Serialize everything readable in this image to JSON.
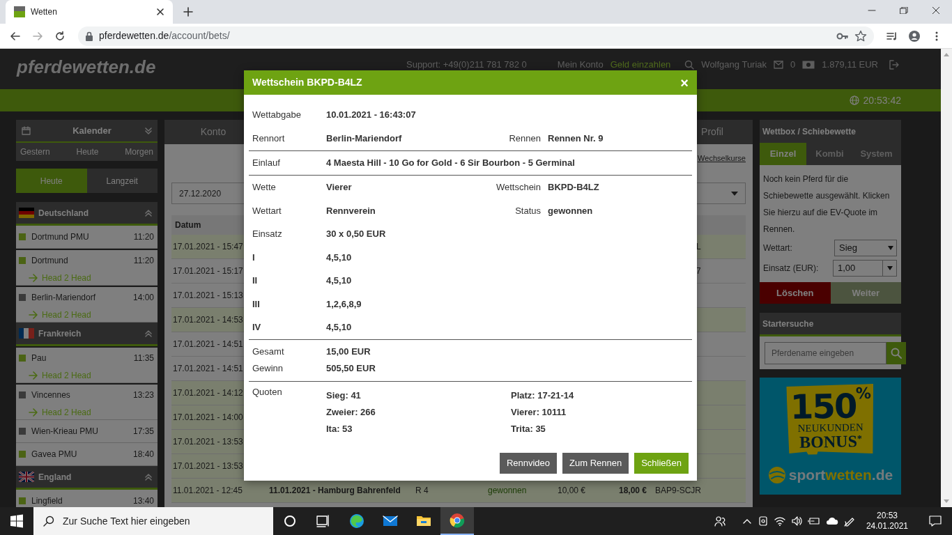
{
  "browser": {
    "tab_title": "Wetten",
    "url_host": "pferdewetten.de",
    "url_path": "/account/bets/"
  },
  "site_header": {
    "logo": "pferdewetten.de",
    "support": "Support: +49(0)211 781 782 0",
    "account_link": "Mein Konto",
    "deposit_link": "Geld einzahlen",
    "user": "Wolfgang Turiak",
    "messages": "0",
    "balance": "1.879,11 EUR",
    "clock": "20:53:42"
  },
  "calendar": {
    "title": "Kalender",
    "expanded": false,
    "days": [
      "Gestern",
      "Heute",
      "Morgen"
    ],
    "tabs": [
      {
        "label": "Heute",
        "selected": true
      },
      {
        "label": "Langzeit",
        "selected": false
      }
    ]
  },
  "countries": [
    {
      "name": "Deutschland",
      "kind": "de",
      "expanded": true,
      "races": [
        {
          "name": "Dortmund PMU",
          "time": "11:20",
          "color": "#4b6314"
        },
        {
          "name": "Dortmund",
          "time": "11:20",
          "color": "#4b6314",
          "link": "Head 2 Head"
        },
        {
          "name": "Berlin-Mariendorf",
          "time": "14:00",
          "color": "#3a3a3a",
          "link": "Head 2 Head"
        }
      ]
    },
    {
      "name": "Frankreich",
      "kind": "fr",
      "expanded": true,
      "races": [
        {
          "name": "Pau",
          "time": "11:35",
          "color": "#4b6314",
          "link": "Head 2 Head"
        },
        {
          "name": "Vincennes",
          "time": "13:23",
          "color": "#3a3a3a",
          "link": "Head 2 Head"
        },
        {
          "name": "Wien-Krieau PMU",
          "time": "17:35",
          "color": "#3a3a3a"
        },
        {
          "name": "Gavea PMU",
          "time": "18:40",
          "color": "#4b6314"
        }
      ]
    },
    {
      "name": "England",
      "kind": "gb",
      "expanded": true,
      "races": [
        {
          "name": "Lingfield",
          "time": "13:40",
          "color": "#4b6314"
        }
      ]
    }
  ],
  "account": {
    "tabs": [
      {
        "label": "Konto",
        "selected": false
      },
      {
        "label": "Profil",
        "selected": false
      }
    ],
    "rate_link": "Wechselkurse",
    "date_from": "27.12.2020",
    "table": {
      "columns": [
        "Datum"
      ],
      "rows": [
        {
          "cells": [
            "17.01.2021 - 15:47"
          ],
          "tail": "L",
          "highlight": true
        },
        {
          "cells": [
            "17.01.2021 - 15:17"
          ],
          "tail": "7",
          "highlight": false
        },
        {
          "cells": [
            "17.01.2021 - 15:13"
          ],
          "highlight": false
        },
        {
          "cells": [
            "17.01.2021 - 14:53"
          ],
          "highlight": true
        },
        {
          "cells": [
            "17.01.2021 - 14:51"
          ],
          "highlight": false
        },
        {
          "cells": [
            "17.01.2021 - 14:51"
          ],
          "highlight": false
        },
        {
          "cells": [
            "17.01.2021 - 14:12"
          ],
          "highlight": true
        },
        {
          "cells": [
            "17.01.2021 - 14:00"
          ],
          "highlight": true
        },
        {
          "cells": [
            "17.01.2021 - 13:53"
          ],
          "highlight": true
        },
        {
          "cells": [
            "17.01.2021 - 13:53"
          ],
          "highlight": true
        },
        {
          "cells": [
            "11.01.2021 - 12:45",
            "11.01.2021 - Hamburg Bahrenfeld",
            "R 4",
            "gewonnen",
            "10,00 €",
            "18,00 €",
            "BAP9-SCJR"
          ],
          "highlight": true
        }
      ]
    }
  },
  "wettbox": {
    "title": "Wettbox / Schiebewette",
    "tabs": [
      {
        "label": "Einzel",
        "selected": true
      },
      {
        "label": "Kombi",
        "selected": false
      },
      {
        "label": "System",
        "selected": false
      }
    ],
    "message": "Noch kein Pferd für die Schiebewette ausgewählt. Klicken Sie hierzu auf die EV-Quote im Rennen.",
    "bet_type_label": "Wettart:",
    "bet_type": "Sieg",
    "stake_label": "Einsatz (EUR):",
    "stake": "1,00",
    "buttons": [
      {
        "label": "Löschen",
        "kind": "danger"
      },
      {
        "label": "Weiter",
        "kind": "muted"
      }
    ]
  },
  "starter_search": {
    "title": "Startersuche",
    "placeholder": "Pferdename eingeben"
  },
  "ad": {
    "percent": "150$^{%}$",
    "line1": "NEUKUNDEN",
    "line2": "BONUS$^{*}$",
    "brand": [
      "sport",
      "wetten",
      ".de"
    ]
  },
  "bet_slip": {
    "title": "Wettschein BKPD-B4LZ",
    "close": "×",
    "sections": [
      {
        "kind": "detail",
        "rows": [
          {
            "kind": "field",
            "label": "Wettabgabe",
            "value": "10.01.2021 - 16:43:07"
          },
          {
            "kind": "field",
            "label": "Rennort",
            "value": "Berlin-Mariendorf",
            "label_2": "Rennen",
            "value_2": "Rennen Nr. 9"
          }
        ]
      },
      {
        "kind": "detail",
        "rows": [
          {
            "kind": "field",
            "label": "Einlauf",
            "value": "4 Maesta Hill - 10 Go for Gold - 6 Sir Bourbon - 5 Germinal"
          }
        ]
      },
      {
        "kind": "legs",
        "rows": [
          {
            "kind": "field",
            "label": "Wette",
            "value": "Vierer",
            "label_2": "Wettschein",
            "value_2": "BKPD-B4LZ"
          },
          {
            "kind": "field",
            "label": "Wettart",
            "value": "Rennverein",
            "label_2": "Status",
            "value_2": "gewonnen"
          },
          {
            "kind": "field",
            "label": "Einsatz",
            "value": "30 x 0,50 EUR"
          },
          {
            "kind": "position",
            "label": "I",
            "value": "4,5,10"
          },
          {
            "kind": "position",
            "label": "II",
            "value": "4,5,10"
          },
          {
            "kind": "position",
            "label": "III",
            "value": "1,2,6,8,9"
          },
          {
            "kind": "position",
            "label": "IV",
            "value": "4,5,10"
          }
        ]
      },
      {
        "kind": "totals",
        "rows": [
          {
            "kind": "field",
            "label": "Gesamt",
            "value": "15,00 EUR"
          },
          {
            "kind": "field",
            "label": "Gewinn",
            "value": "505,50 EUR"
          }
        ]
      },
      {
        "kind": "odds",
        "label": "Quoten",
        "odds": [
          [
            "Sieg: 41",
            "Platz: 17-21-14"
          ],
          [
            "Zweier: 266",
            "Vierer: 10111"
          ],
          [
            "Ita: 53",
            "Trita: 35"
          ]
        ]
      }
    ],
    "buttons": [
      {
        "label": "Rennvideo",
        "kind": "secondary"
      },
      {
        "label": "Zum Rennen",
        "kind": "secondary"
      },
      {
        "label": "Schließen",
        "kind": "primary"
      }
    ]
  },
  "taskbar": {
    "search_placeholder": "Zur Suche Text hier eingeben",
    "time": "20:53",
    "date": "24.01.2021"
  }
}
